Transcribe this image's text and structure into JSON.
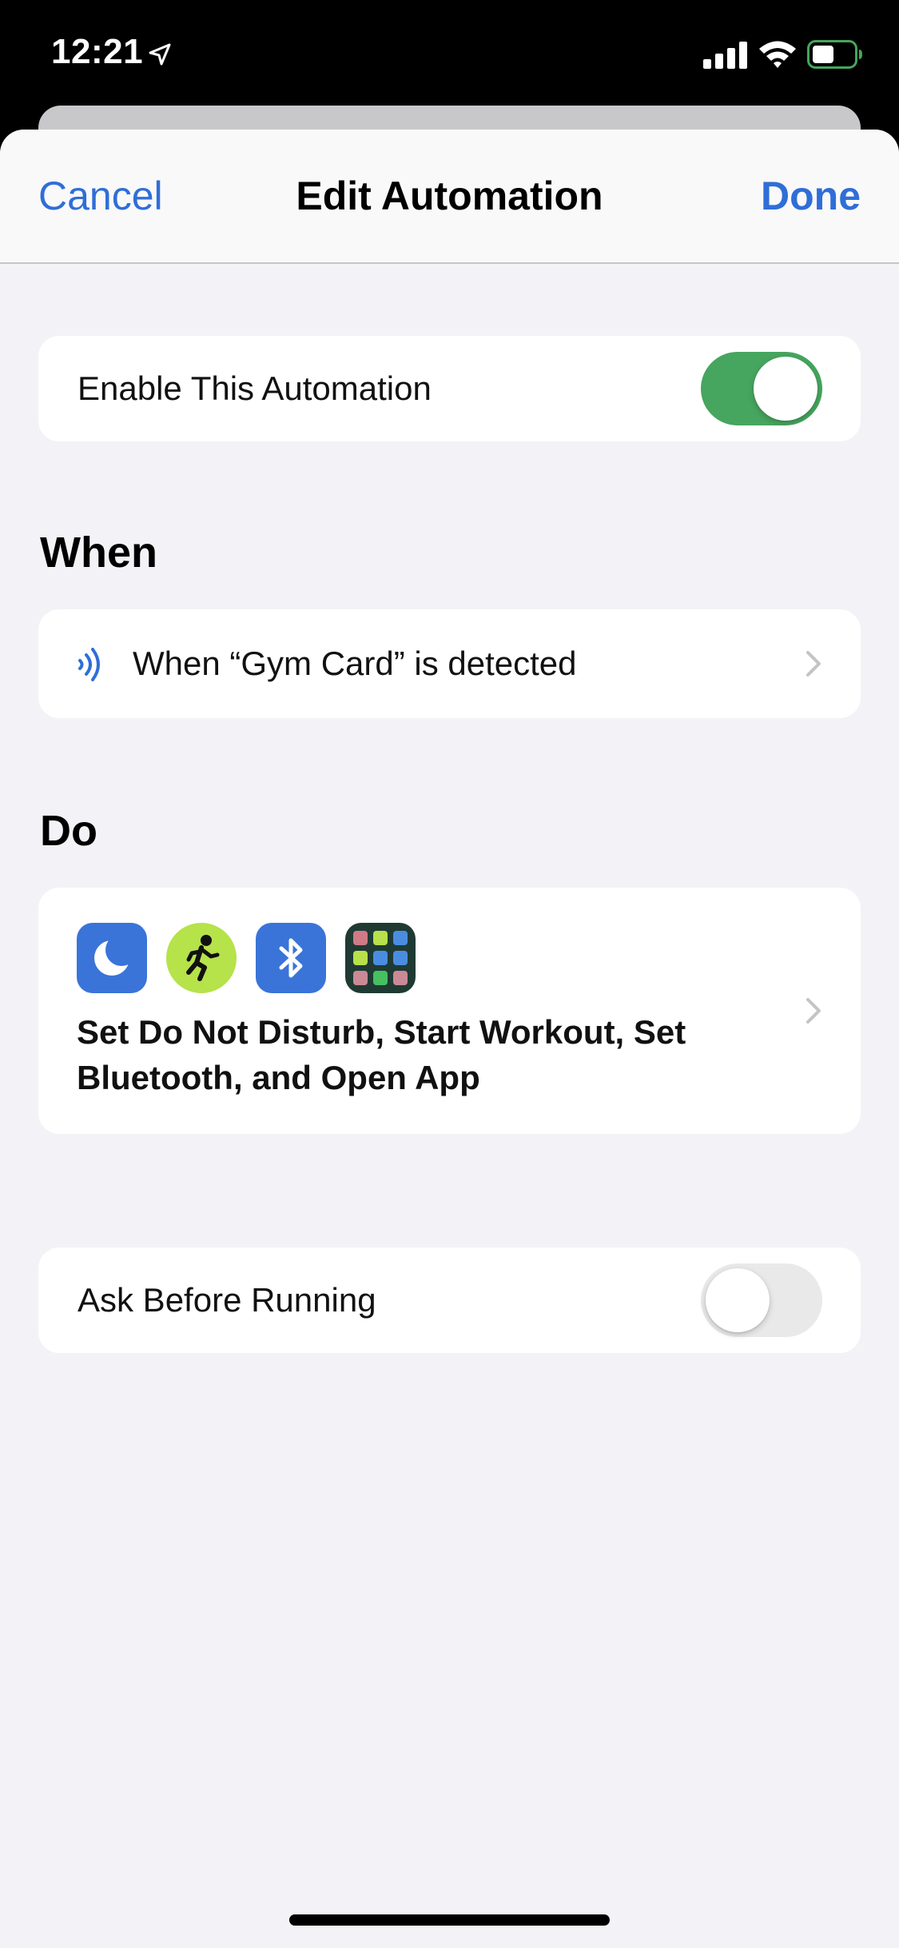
{
  "status_bar": {
    "time": "12:21",
    "icons": [
      "location-arrow-icon",
      "cellular-signal-icon",
      "wifi-icon",
      "battery-icon"
    ]
  },
  "nav": {
    "cancel_label": "Cancel",
    "title": "Edit Automation",
    "done_label": "Done"
  },
  "enable_row": {
    "label": "Enable This Automation",
    "toggle_on": true,
    "toggle_color": "#46a55e"
  },
  "when_section": {
    "header": "When",
    "trigger_label": "When “Gym Card” is detected",
    "icon": "nfc-icon"
  },
  "do_section": {
    "header": "Do",
    "action_icons": [
      "moon-icon",
      "running-figure-icon",
      "bluetooth-icon",
      "app-grid-icon"
    ],
    "actions_label": "Set Do Not Disturb, Start Workout, Set Bluetooth, and Open App"
  },
  "ask_row": {
    "label": "Ask Before Running",
    "toggle_on": false
  },
  "colors": {
    "accent": "#2f6ed8",
    "background": "#f2f2f7",
    "card": "#ffffff"
  }
}
